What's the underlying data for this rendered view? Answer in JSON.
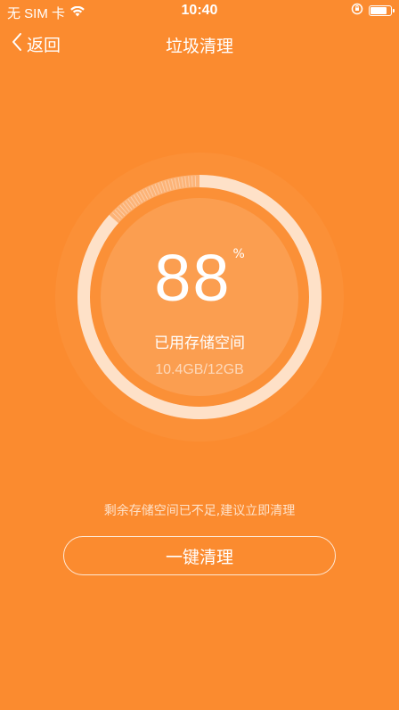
{
  "status_bar": {
    "carrier": "无 SIM 卡",
    "time": "10:40",
    "battery_level": 0.85
  },
  "nav": {
    "back_label": "返回",
    "title": "垃圾清理"
  },
  "storage": {
    "percent_value": "88",
    "percent_unit": "%",
    "used_fraction": 0.867,
    "used_label": "已用存储空间",
    "used_amount": "10.4GB/12GB"
  },
  "warning_text": "剩余存储空间已不足,建议立即清理",
  "clean_button_label": "一键清理",
  "colors": {
    "background": "#FB8B2F",
    "accent_ring": "#FFFFFF"
  }
}
